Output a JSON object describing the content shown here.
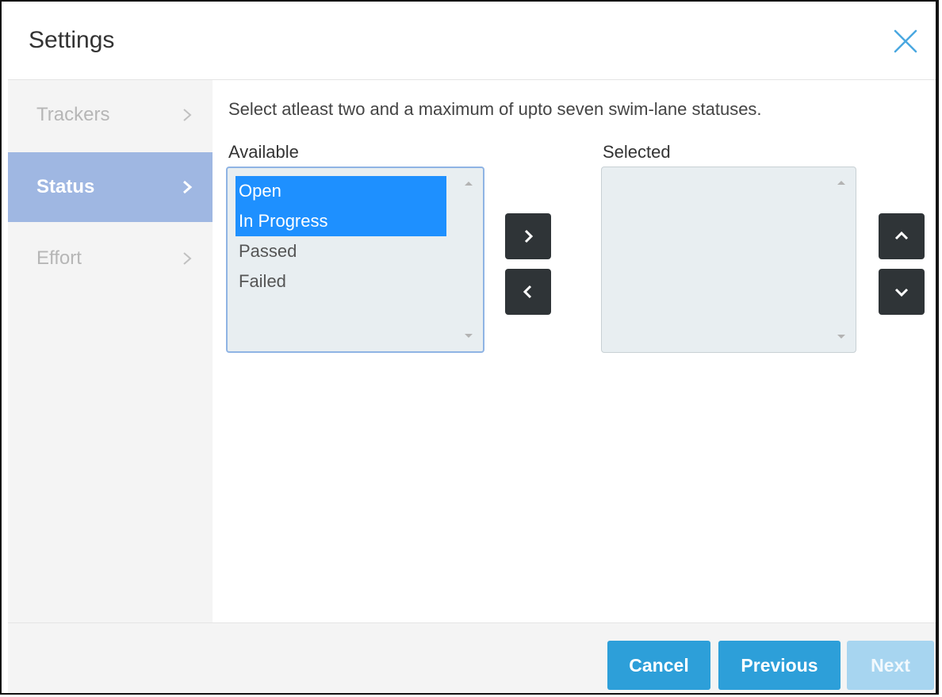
{
  "dialog": {
    "title": "Settings"
  },
  "sidebar": {
    "items": [
      {
        "label": "Trackers",
        "state": "disabled"
      },
      {
        "label": "Status",
        "state": "active"
      },
      {
        "label": "Effort",
        "state": "disabled"
      }
    ]
  },
  "main": {
    "instruction": "Select atleast two and a maximum of upto seven swim-lane statuses.",
    "available": {
      "label": "Available",
      "options": [
        {
          "label": "Open",
          "selected": true
        },
        {
          "label": "In Progress",
          "selected": true
        },
        {
          "label": "Passed",
          "selected": false
        },
        {
          "label": "Failed",
          "selected": false
        }
      ]
    },
    "selected": {
      "label": "Selected",
      "options": []
    }
  },
  "icons": {
    "close": "close-icon",
    "move_right": "chevron-right-icon",
    "move_left": "chevron-left-icon",
    "move_up": "chevron-up-icon",
    "move_down": "chevron-down-icon"
  },
  "footer": {
    "cancel": "Cancel",
    "previous": "Previous",
    "next": "Next"
  },
  "colors": {
    "accent": "#2d9fd9",
    "active_nav": "#9fb7e2",
    "selection": "#1e90ff",
    "icon_button": "#2f3437",
    "close_icon": "#4aa8e0"
  }
}
